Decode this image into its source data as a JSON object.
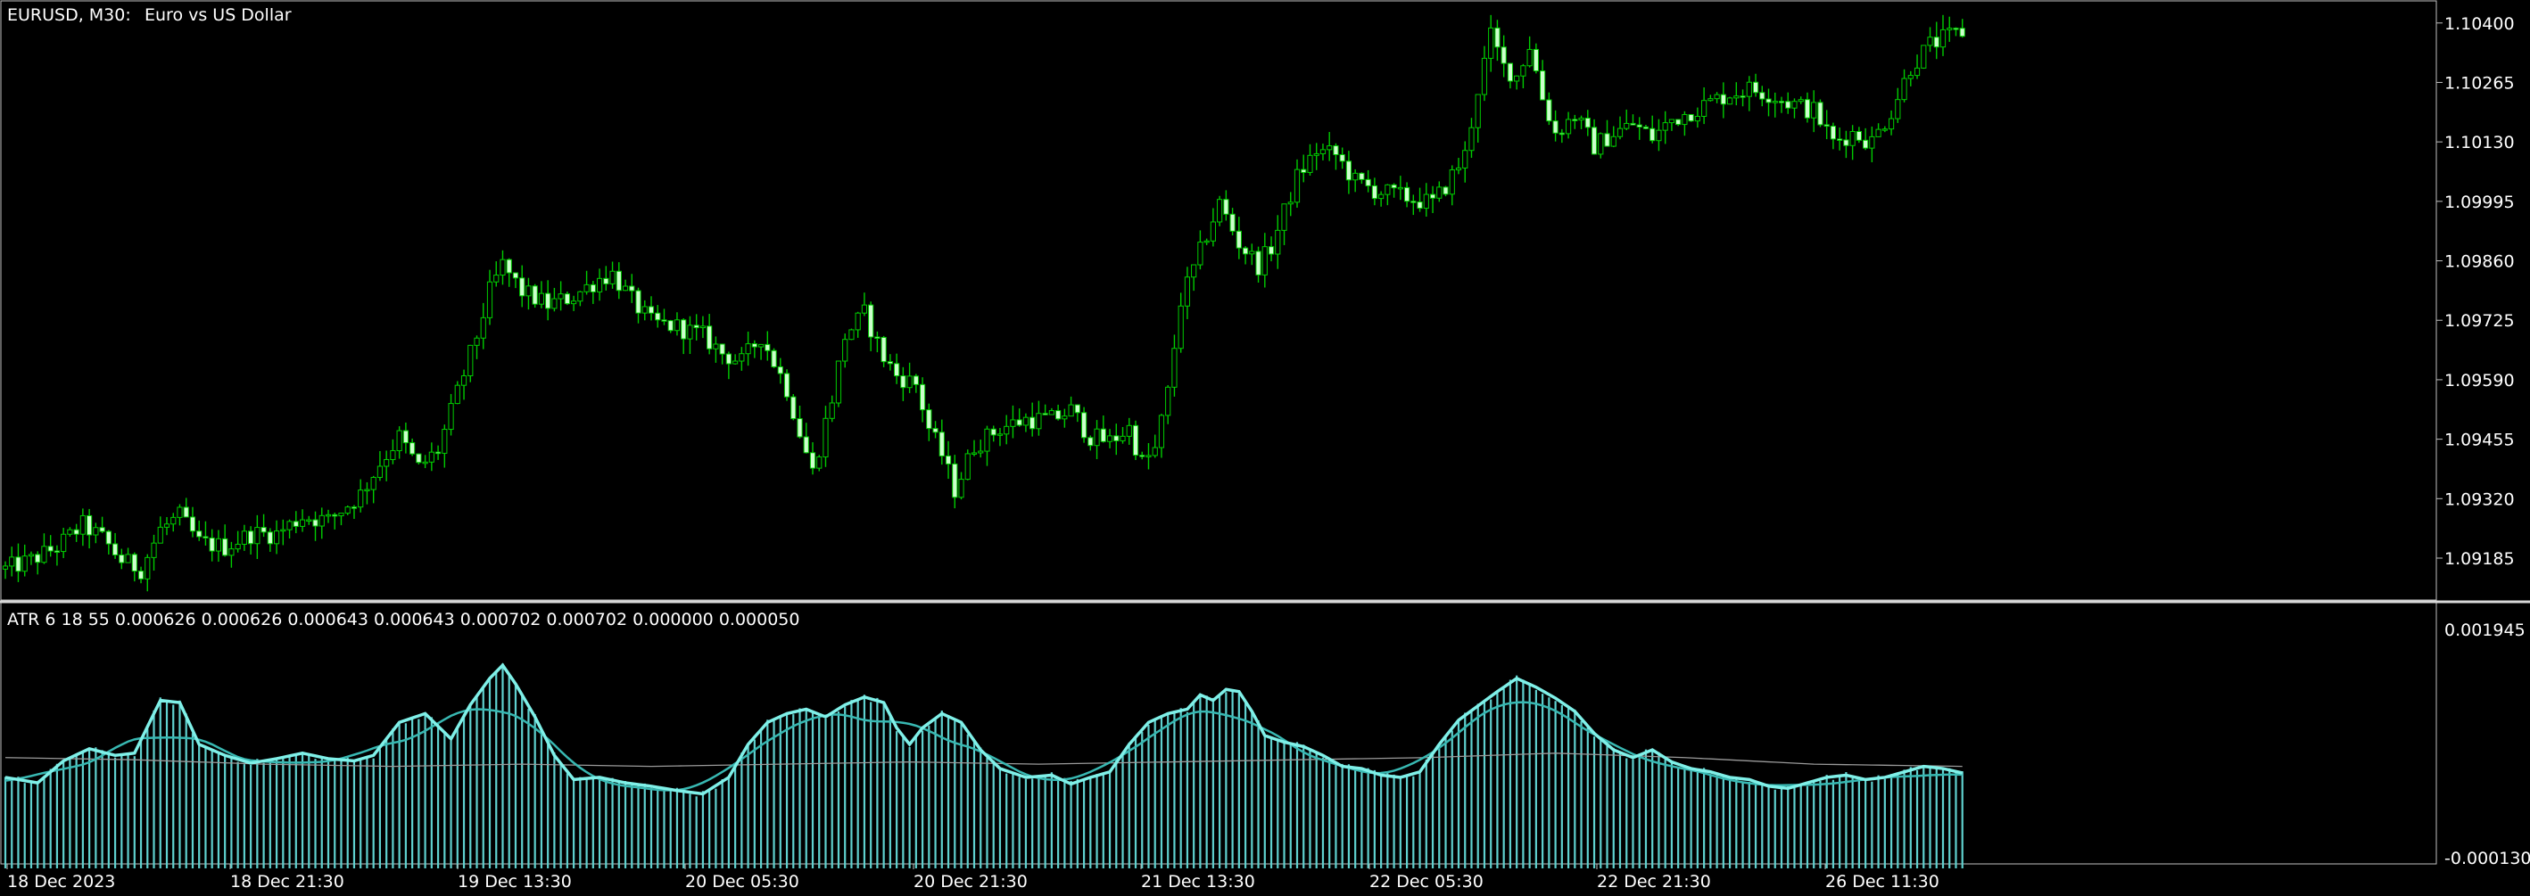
{
  "header": {
    "symbol_timeframe": "EURUSD, M30:",
    "description": "Euro vs US Dollar"
  },
  "indicator": {
    "header": "ATR 6 18 55 0.000626 0.000626 0.000643 0.000643 0.000702 0.000702 0.000000 0.000050"
  },
  "colors": {
    "background": "#000000",
    "candle_up_body": "#000000",
    "candle_down_body": "#ccffcc",
    "candle_outline": "#00cc00",
    "wick": "#00cc00",
    "atr_histogram": "#5fd1cf",
    "atr_line_fast": "#7ff0e8",
    "atr_line_mid": "#38b8b2",
    "atr_line_slow": "#9a9a9a",
    "text": "#ffffff",
    "separator": "#c8c8c8"
  },
  "chart_data": [
    {
      "type": "candlestick",
      "name": "EURUSD M30 price",
      "y_axis_labels": [
        "1.10400",
        "1.10265",
        "1.10130",
        "1.09995",
        "1.09860",
        "1.09725",
        "1.09590",
        "1.09455",
        "1.09320",
        "1.09185"
      ],
      "ylim": [
        1.091,
        1.1044
      ],
      "x_axis_labels": [
        "18 Dec 2023",
        "18 Dec 21:30",
        "19 Dec 13:30",
        "20 Dec 05:30",
        "20 Dec 21:30",
        "21 Dec 13:30",
        "22 Dec 05:30",
        "22 Dec 21:30",
        "26 Dec 11:30"
      ],
      "close_path": [
        [
          0,
          1.0916
        ],
        [
          4,
          1.0918
        ],
        [
          8,
          1.0921
        ],
        [
          12,
          1.0926
        ],
        [
          15,
          1.0923
        ],
        [
          18,
          1.0918
        ],
        [
          21,
          1.0916
        ],
        [
          24,
          1.0925
        ],
        [
          27,
          1.0928
        ],
        [
          30,
          1.0922
        ],
        [
          34,
          1.0921
        ],
        [
          38,
          1.0924
        ],
        [
          42,
          1.0924
        ],
        [
          46,
          1.0928
        ],
        [
          50,
          1.0927
        ],
        [
          55,
          1.0933
        ],
        [
          58,
          1.094
        ],
        [
          61,
          1.0946
        ],
        [
          64,
          1.0939
        ],
        [
          67,
          1.0943
        ],
        [
          70,
          1.0956
        ],
        [
          73,
          1.0969
        ],
        [
          75,
          1.0979
        ],
        [
          77,
          1.0985
        ],
        [
          80,
          1.0979
        ],
        [
          84,
          1.0976
        ],
        [
          88,
          1.0978
        ],
        [
          92,
          1.0982
        ],
        [
          94,
          1.0983
        ],
        [
          97,
          1.0977
        ],
        [
          100,
          1.0972
        ],
        [
          104,
          1.0971
        ],
        [
          108,
          1.0969
        ],
        [
          111,
          1.0965
        ],
        [
          114,
          1.0963
        ],
        [
          117,
          1.0969
        ],
        [
          119,
          1.0963
        ],
        [
          121,
          1.0957
        ],
        [
          123,
          1.0947
        ],
        [
          125,
          1.0938
        ],
        [
          128,
          1.0955
        ],
        [
          130,
          1.0969
        ],
        [
          133,
          1.0974
        ],
        [
          136,
          1.0964
        ],
        [
          138,
          1.096
        ],
        [
          141,
          1.0958
        ],
        [
          143,
          1.0948
        ],
        [
          145,
          1.0942
        ],
        [
          147,
          1.0934
        ],
        [
          150,
          1.0944
        ],
        [
          154,
          1.0948
        ],
        [
          158,
          1.095
        ],
        [
          162,
          1.095
        ],
        [
          165,
          1.0952
        ],
        [
          168,
          1.0946
        ],
        [
          171,
          1.0945
        ],
        [
          174,
          1.0948
        ],
        [
          176,
          1.094
        ],
        [
          178,
          1.0943
        ],
        [
          180,
          1.0956
        ],
        [
          182,
          1.0977
        ],
        [
          184,
          1.0984
        ],
        [
          186,
          1.0992
        ],
        [
          188,
          1.0999
        ],
        [
          191,
          1.099
        ],
        [
          194,
          1.0985
        ],
        [
          196,
          1.0989
        ],
        [
          198,
          1.0997
        ],
        [
          200,
          1.1005
        ],
        [
          203,
          1.1011
        ],
        [
          206,
          1.101
        ],
        [
          209,
          1.1004
        ],
        [
          212,
          1.1002
        ],
        [
          215,
          1.1001
        ],
        [
          218,
          1.1
        ],
        [
          221,
          1.0999
        ],
        [
          223,
          1.1003
        ],
        [
          226,
          1.101
        ],
        [
          228,
          1.1025
        ],
        [
          230,
          1.1037
        ],
        [
          232,
          1.103
        ],
        [
          234,
          1.1028
        ],
        [
          236,
          1.1035
        ],
        [
          238,
          1.1023
        ],
        [
          240,
          1.1015
        ],
        [
          243,
          1.1019
        ],
        [
          246,
          1.1012
        ],
        [
          249,
          1.1015
        ],
        [
          252,
          1.1017
        ],
        [
          255,
          1.1014
        ],
        [
          258,
          1.1018
        ],
        [
          261,
          1.102
        ],
        [
          264,
          1.1022
        ],
        [
          267,
          1.1024
        ],
        [
          270,
          1.1025
        ],
        [
          273,
          1.1024
        ],
        [
          276,
          1.1022
        ],
        [
          280,
          1.102
        ],
        [
          283,
          1.1013
        ],
        [
          286,
          1.1015
        ],
        [
          289,
          1.1013
        ],
        [
          292,
          1.102
        ],
        [
          295,
          1.103
        ],
        [
          298,
          1.1035
        ],
        [
          301,
          1.1037
        ],
        [
          303,
          1.1038
        ]
      ]
    },
    {
      "type": "line",
      "name": "ATR indicator",
      "y_axis_labels": [
        "0.001945",
        "-0.000130"
      ],
      "ylim": [
        -0.00013,
        0.001945
      ],
      "values_at_cursor": [
        0.000626,
        0.000626,
        0.000643,
        0.000643,
        0.000702,
        0.000702,
        0.0,
        5e-05
      ],
      "atr_fast": [
        [
          0,
          0.0006
        ],
        [
          5,
          0.00055
        ],
        [
          9,
          0.00075
        ],
        [
          13,
          0.00086
        ],
        [
          17,
          0.0008
        ],
        [
          20,
          0.00082
        ],
        [
          24,
          0.0013
        ],
        [
          27,
          0.00128
        ],
        [
          30,
          0.0009
        ],
        [
          34,
          0.0008
        ],
        [
          38,
          0.00073
        ],
        [
          42,
          0.00077
        ],
        [
          46,
          0.00082
        ],
        [
          50,
          0.00077
        ],
        [
          54,
          0.00075
        ],
        [
          57,
          0.0008
        ],
        [
          61,
          0.0011
        ],
        [
          65,
          0.00118
        ],
        [
          69,
          0.00095
        ],
        [
          72,
          0.00126
        ],
        [
          75,
          0.0015
        ],
        [
          77,
          0.00162
        ],
        [
          79,
          0.00145
        ],
        [
          82,
          0.00115
        ],
        [
          85,
          0.0008
        ],
        [
          88,
          0.00058
        ],
        [
          92,
          0.0006
        ],
        [
          96,
          0.00055
        ],
        [
          100,
          0.00052
        ],
        [
          104,
          0.00048
        ],
        [
          108,
          0.00045
        ],
        [
          112,
          0.0006
        ],
        [
          115,
          0.0009
        ],
        [
          118,
          0.0011
        ],
        [
          121,
          0.00118
        ],
        [
          124,
          0.00122
        ],
        [
          127,
          0.00115
        ],
        [
          130,
          0.00126
        ],
        [
          133,
          0.00133
        ],
        [
          136,
          0.00128
        ],
        [
          138,
          0.00105
        ],
        [
          140,
          0.0009
        ],
        [
          142,
          0.00105
        ],
        [
          145,
          0.00118
        ],
        [
          148,
          0.0011
        ],
        [
          151,
          0.00085
        ],
        [
          154,
          0.00068
        ],
        [
          158,
          0.0006
        ],
        [
          162,
          0.00062
        ],
        [
          165,
          0.00054
        ],
        [
          168,
          0.0006
        ],
        [
          171,
          0.00065
        ],
        [
          174,
          0.0009
        ],
        [
          177,
          0.0011
        ],
        [
          180,
          0.00118
        ],
        [
          183,
          0.00122
        ],
        [
          185,
          0.00135
        ],
        [
          187,
          0.0013
        ],
        [
          189,
          0.0014
        ],
        [
          191,
          0.00138
        ],
        [
          193,
          0.0012
        ],
        [
          195,
          0.00098
        ],
        [
          198,
          0.00092
        ],
        [
          201,
          0.00088
        ],
        [
          204,
          0.0008
        ],
        [
          207,
          0.0007
        ],
        [
          210,
          0.00068
        ],
        [
          213,
          0.00062
        ],
        [
          216,
          0.0006
        ],
        [
          219,
          0.00065
        ],
        [
          222,
          0.0009
        ],
        [
          225,
          0.00112
        ],
        [
          228,
          0.00125
        ],
        [
          231,
          0.00138
        ],
        [
          234,
          0.0015
        ],
        [
          237,
          0.00142
        ],
        [
          240,
          0.00132
        ],
        [
          243,
          0.0012
        ],
        [
          246,
          0.001
        ],
        [
          249,
          0.00085
        ],
        [
          252,
          0.00078
        ],
        [
          255,
          0.00085
        ],
        [
          258,
          0.00074
        ],
        [
          261,
          0.00068
        ],
        [
          264,
          0.00065
        ],
        [
          267,
          0.0006
        ],
        [
          270,
          0.00058
        ],
        [
          273,
          0.00052
        ],
        [
          276,
          0.0005
        ],
        [
          279,
          0.00055
        ],
        [
          282,
          0.0006
        ],
        [
          285,
          0.00062
        ],
        [
          288,
          0.00058
        ],
        [
          291,
          0.0006
        ],
        [
          294,
          0.00065
        ],
        [
          297,
          0.0007
        ],
        [
          300,
          0.00068
        ],
        [
          303,
          0.00064
        ]
      ],
      "atr_slow": [
        [
          0,
          0.00078
        ],
        [
          20,
          0.00076
        ],
        [
          40,
          0.00072
        ],
        [
          60,
          0.0007
        ],
        [
          80,
          0.00072
        ],
        [
          100,
          0.0007
        ],
        [
          120,
          0.00072
        ],
        [
          140,
          0.00074
        ],
        [
          160,
          0.00072
        ],
        [
          180,
          0.00074
        ],
        [
          200,
          0.00076
        ],
        [
          220,
          0.00078
        ],
        [
          240,
          0.00082
        ],
        [
          260,
          0.00078
        ],
        [
          280,
          0.00072
        ],
        [
          303,
          0.0007
        ]
      ]
    }
  ]
}
